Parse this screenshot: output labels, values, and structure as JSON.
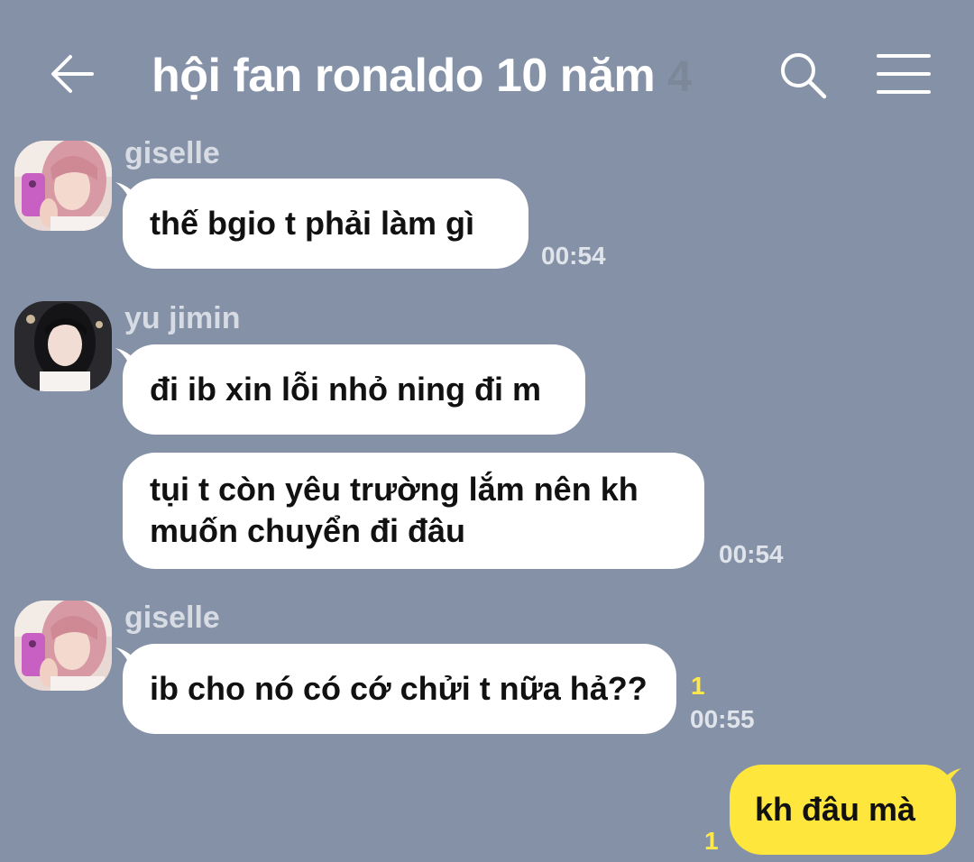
{
  "header": {
    "title": "hội fan ronaldo 10 năm",
    "member_count": "4"
  },
  "messages": [
    {
      "sender": "giselle",
      "bubbles": [
        "thế bgio t phải làm gì"
      ],
      "time": "00:54"
    },
    {
      "sender": "yu jimin",
      "bubbles": [
        "đi ib xin lỗi nhỏ ning đi m",
        "tụi t còn yêu trường lắm nên kh muốn chuyển đi đâu"
      ],
      "bubble2_lines": [
        "tụi t còn yêu trường lắm nên kh",
        "muốn chuyển đi đâu"
      ],
      "time": "00:54"
    },
    {
      "sender": "giselle",
      "bubbles": [
        "ib cho nó có cớ chửi t nữa hả??"
      ],
      "unread": "1",
      "time": "00:55"
    }
  ],
  "my_message": {
    "text": "kh đâu mà",
    "unread": "1"
  },
  "colors": {
    "background": "#8591a6",
    "incoming_bubble": "#ffffff",
    "outgoing_bubble": "#fee63c",
    "unread": "#ffe94a"
  },
  "icons": [
    "back-arrow-icon",
    "search-icon",
    "menu-icon"
  ]
}
